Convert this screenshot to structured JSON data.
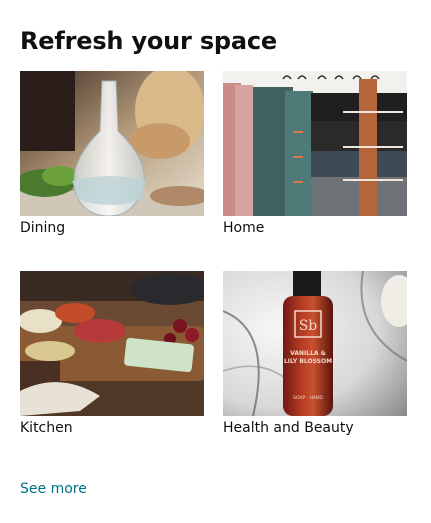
{
  "card": {
    "title": "Refresh your space",
    "tiles": [
      {
        "label": "Dining"
      },
      {
        "label": "Home"
      },
      {
        "label": "Kitchen"
      },
      {
        "label": "Health and Beauty"
      }
    ],
    "see_more": "See more",
    "product_label_text": [
      "Sb",
      "VANILLA &",
      "LILY BLOSSOM",
      "SOAP · HAND"
    ]
  },
  "colors": {
    "link": "#007185",
    "text": "#0f1111",
    "background": "#ffffff"
  }
}
